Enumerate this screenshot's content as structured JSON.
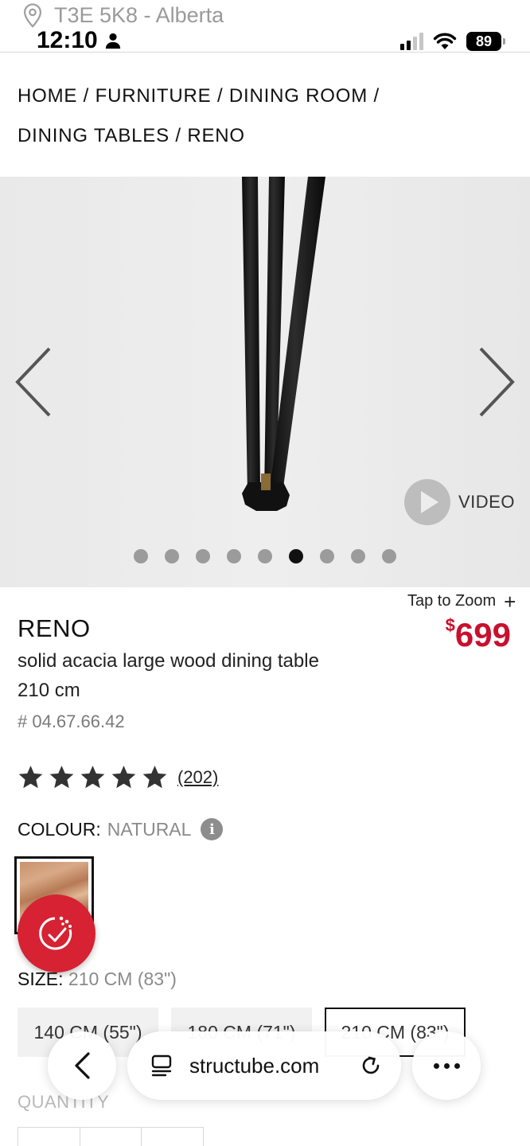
{
  "status_bar": {
    "location": "T3E 5K8 - Alberta",
    "time": "12:10",
    "battery": "89"
  },
  "breadcrumb": {
    "items": [
      "HOME",
      "FURNITURE",
      "DINING ROOM",
      "DINING TABLES",
      "RENO"
    ],
    "separator": "/"
  },
  "gallery": {
    "video_label": "VIDEO",
    "total_images": 9,
    "active_index": 5
  },
  "product": {
    "tap_to_zoom": "Tap to Zoom",
    "name": "RENO",
    "price_currency": "$",
    "price": "699",
    "description": "solid acacia large wood dining table 210 cm",
    "sku": "# 04.67.66.42",
    "rating_stars": 5,
    "review_count": "(202)",
    "colour_label": "COLOUR:",
    "colour_value": "NATURAL",
    "size_label": "SIZE:",
    "size_value": "210 CM (83\")",
    "size_options": [
      "140 CM (55\")",
      "180 CM (71\")",
      "210 CM (83\")"
    ],
    "selected_size_index": 2,
    "quantity_label": "QUANTITY"
  },
  "browser": {
    "domain": "structube.com"
  },
  "colors": {
    "price_red": "#c8102e",
    "fab_red": "#d62232"
  }
}
